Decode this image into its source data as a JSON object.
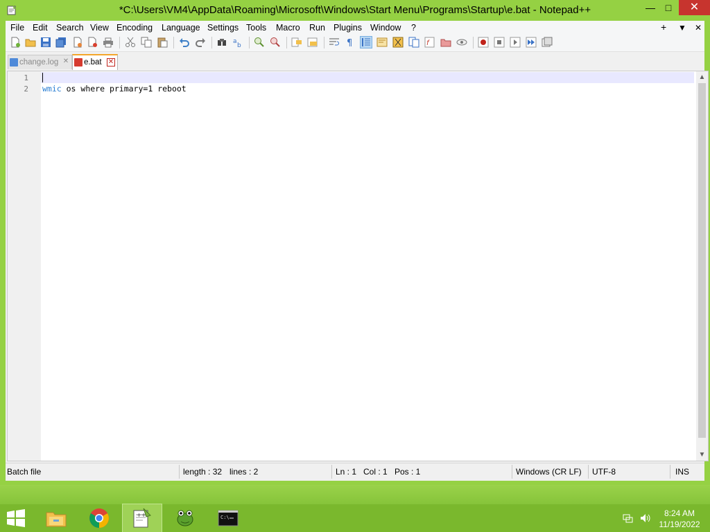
{
  "window": {
    "title": "*C:\\Users\\VM4\\AppData\\Roaming\\Microsoft\\Windows\\Start Menu\\Programs\\Startup\\e.bat - Notepad++",
    "minimize": "—",
    "maximize": "□",
    "close": "✕"
  },
  "menu": {
    "items": [
      "File",
      "Edit",
      "Search",
      "View",
      "Encoding",
      "Language",
      "Settings",
      "Tools",
      "Macro",
      "Run",
      "Plugins",
      "Window",
      "?"
    ],
    "right": [
      "+",
      "▼",
      "✕"
    ]
  },
  "tabs": [
    {
      "label": "change.log",
      "close": "✕"
    },
    {
      "label": "e.bat",
      "close": "✕"
    }
  ],
  "editor": {
    "line_numbers": [
      "1",
      "2"
    ],
    "line2_keyword": "wmic",
    "line2_rest": " os where primary=1 reboot"
  },
  "statusbar": {
    "filetype": "Batch file",
    "length": "length : 32",
    "lines": "lines : 2",
    "ln": "Ln : 1",
    "col": "Col : 1",
    "pos": "Pos : 1",
    "eol": "Windows (CR LF)",
    "encoding": "UTF-8",
    "mode": "INS"
  },
  "taskbar": {
    "items": [
      "file-explorer",
      "chrome",
      "notepad-plus-plus",
      "frog-app",
      "command-prompt"
    ],
    "clock_time": "8:24 AM",
    "clock_date": "11/19/2022"
  },
  "colors": {
    "accent_green": "#8fcc3a",
    "close_red": "#c7342e",
    "keyword_blue": "#2b7fd3",
    "current_line": "#e8e8ff"
  }
}
